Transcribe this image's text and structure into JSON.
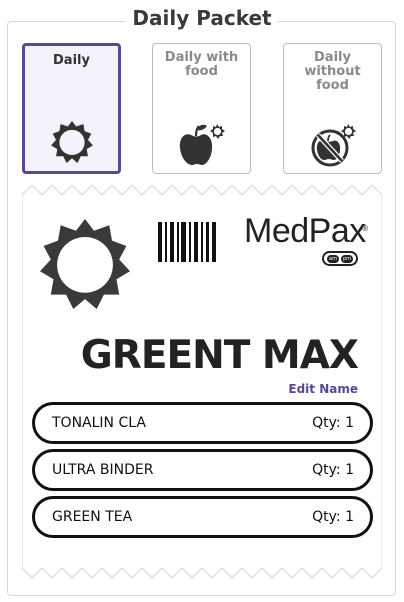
{
  "page": {
    "title": "Daily Packet"
  },
  "options": [
    {
      "label": "Daily",
      "icon": "sun-icon",
      "selected": true
    },
    {
      "label": "Daily with food",
      "icon": "apple-sun-icon",
      "selected": false
    },
    {
      "label": "Daily without food",
      "icon": "no-food-sun-icon",
      "selected": false
    }
  ],
  "packet": {
    "brand": "MedPax",
    "brand_mark": "®",
    "am_label": "am",
    "pm_label": "pm",
    "name": "GREENT MAX",
    "edit_label": "Edit Name",
    "items": [
      {
        "name": "TONALIN CLA",
        "qty": "Qty: 1"
      },
      {
        "name": "ULTRA BINDER",
        "qty": "Qty: 1"
      },
      {
        "name": "GREEN TEA",
        "qty": "Qty: 1"
      }
    ]
  },
  "colors": {
    "accent": "#5a4691",
    "selected_bg": "#f4f3fb",
    "ink": "#222222"
  }
}
